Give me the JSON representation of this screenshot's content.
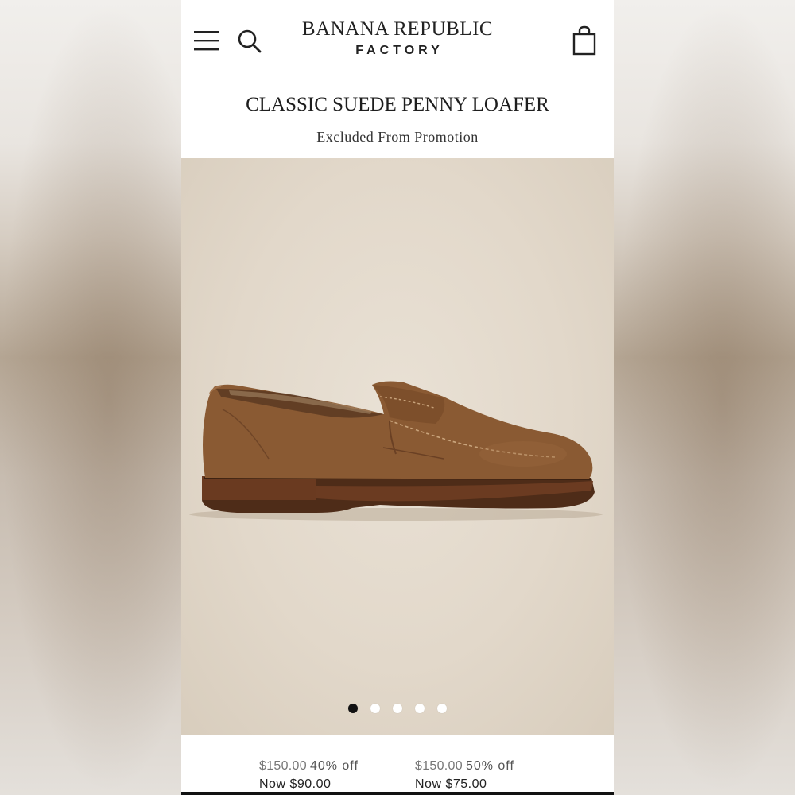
{
  "header": {
    "brand_top": "BANANA REPUBLIC",
    "brand_bottom": "FACTORY",
    "menu_icon": "hamburger-menu-icon",
    "search_icon": "search-icon",
    "bag_icon": "shopping-bag-icon"
  },
  "product": {
    "title": "CLASSIC SUEDE PENNY LOAFER",
    "promo_note": "Excluded From Promotion",
    "image_alt": "brown suede penny loafer",
    "carousel": {
      "total": 5,
      "active_index": 0
    }
  },
  "prices": [
    {
      "original": "$150.00",
      "discount": "40% off",
      "now": "Now $90.00"
    },
    {
      "original": "$150.00",
      "discount": "50% off",
      "now": "Now $75.00"
    }
  ],
  "colors": {
    "text": "#222222",
    "image_bg": "#e2d8ca",
    "suede": "#8a5a33",
    "sole": "#5a3520",
    "active_dot": "#111111",
    "inactive_dot": "#ffffff"
  }
}
